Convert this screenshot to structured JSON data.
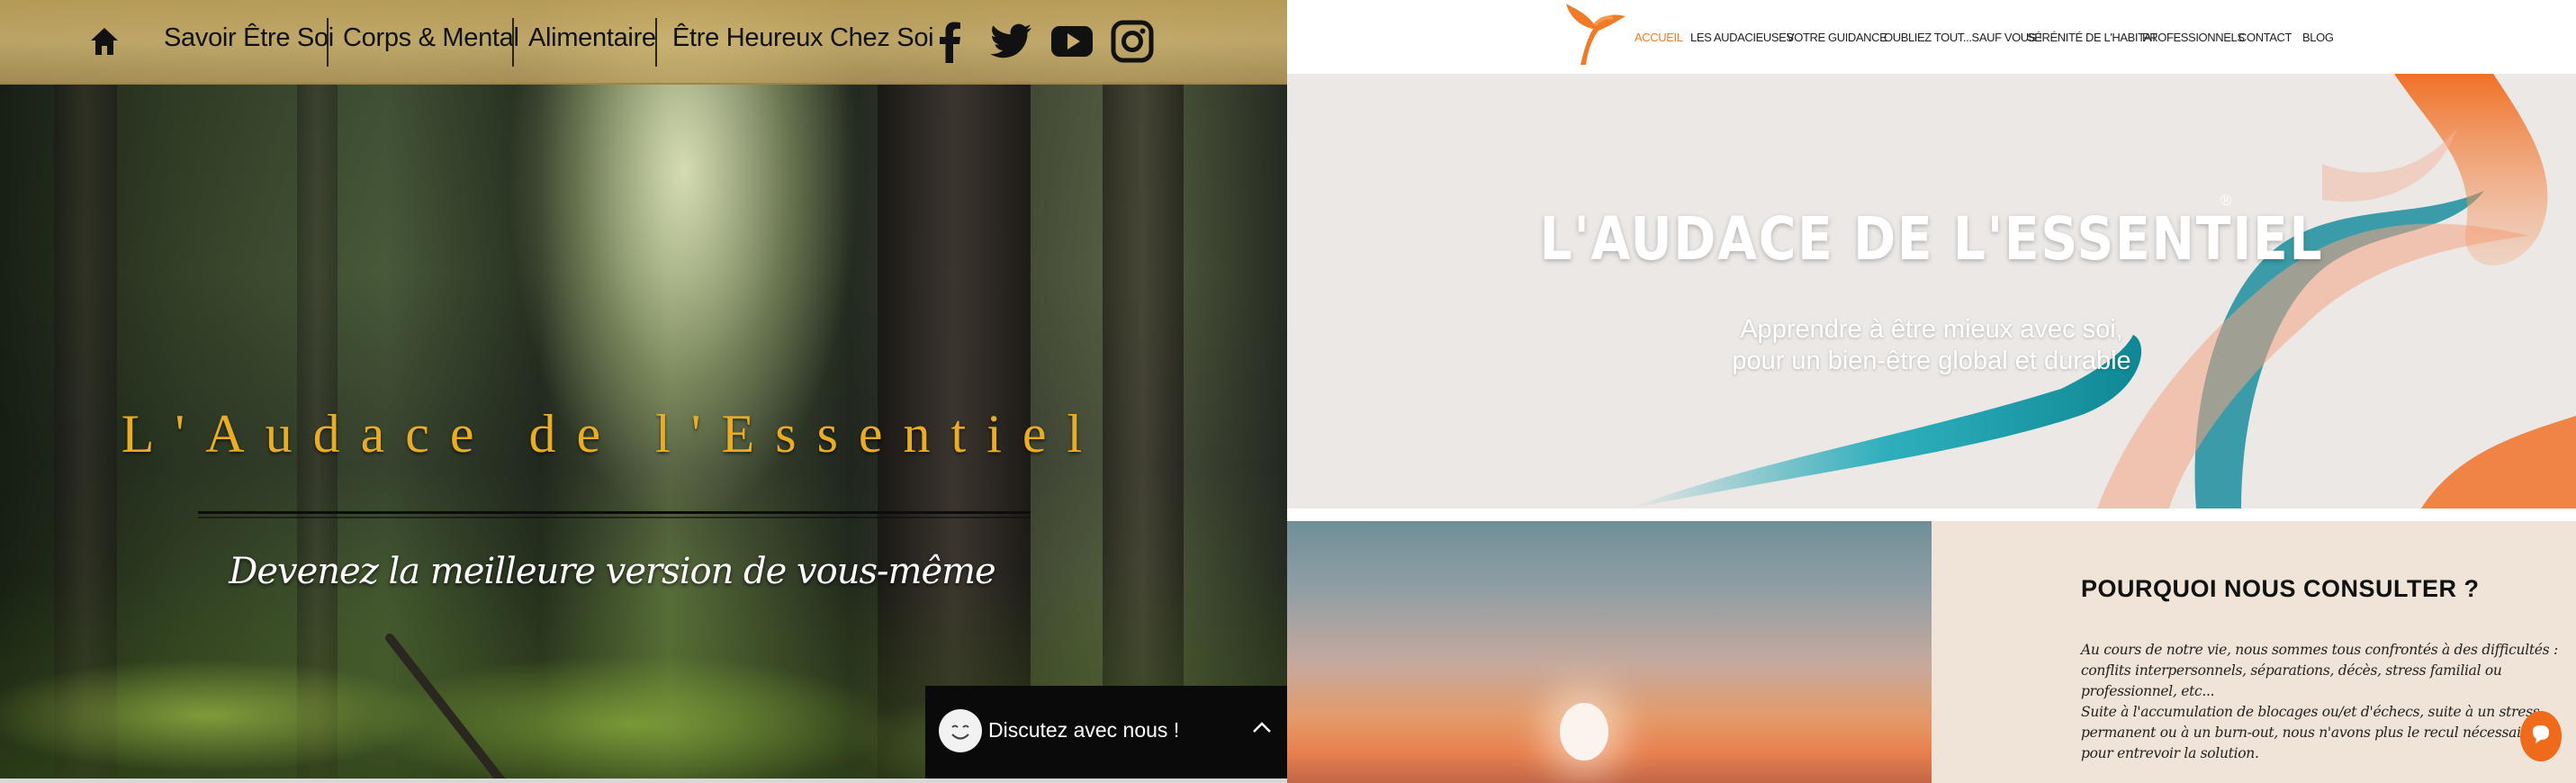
{
  "left_page": {
    "nav": {
      "home_icon": "home-icon",
      "items": [
        "Savoir Être Soi",
        "Corps & Mental",
        "Alimentaire",
        "Être Heureux Chez Soi"
      ],
      "social_icons": [
        "facebook-icon",
        "twitter-icon",
        "youtube-icon",
        "instagram-icon"
      ]
    },
    "hero": {
      "title": "L'Audace de l'Essentiel",
      "subtitle": "Devenez la meilleure version de vous-même"
    },
    "chat": {
      "label": "Discutez avec nous !",
      "icon": "smiley-icon"
    },
    "colors": {
      "nav_bg": "#c9ad6e",
      "title_gold": "#e8ad25",
      "chat_bg": "#0a0a0a"
    }
  },
  "right_page": {
    "nav": {
      "items": [
        "ACCUEIL",
        "LES AUDACIEUSES",
        "VOTRE GUIDANCE",
        "OUBLIEZ TOUT...SAUF VOUS !",
        "SÉRÉNITÉ DE L'HABITAT",
        "PROFESSIONNELS",
        "CONTACT",
        "BLOG"
      ],
      "active": "ACCUEIL"
    },
    "hero": {
      "title": "L'AUDACE DE L'ESSENTIEL",
      "registered_mark": "®",
      "subtitle_line1": "Apprendre à être mieux avec soi,",
      "subtitle_line2": "pour un bien-être global et durable"
    },
    "why": {
      "title": "POURQUOI NOUS CONSULTER ?",
      "lines": [
        "Au cours de notre vie, nous sommes tous confrontés à des difficultés :",
        "conflits interpersonnels, séparations, décès, stress familial ou",
        "professionnel, etc...",
        "Suite à l'accumulation de blocages ou/et d'échecs, suite à un stress",
        "permanent ou à un burn-out, nous n'avons plus le recul nécessaire",
        "pour entrevoir la solution."
      ]
    },
    "chat_button_icon": "chat-bubble-icon",
    "colors": {
      "accent_orange": "#f06a1c",
      "hero_bg": "#ebe8e6",
      "teal": "#1a9fae",
      "why_bg": "#efe4d7"
    }
  }
}
